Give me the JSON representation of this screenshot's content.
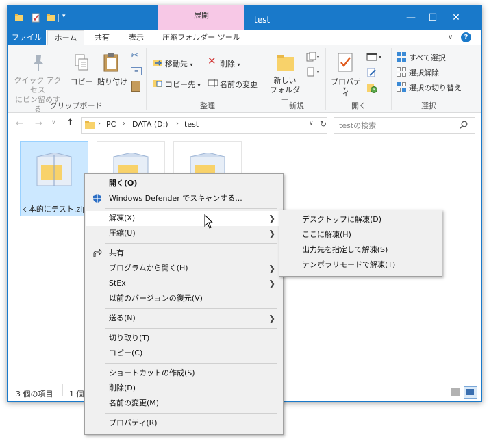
{
  "window": {
    "title": "test",
    "context_tab": "展開",
    "controls": {
      "minimize": "—",
      "maximize": "☐",
      "close": "✕"
    }
  },
  "tabs": {
    "file": "ファイル",
    "home": "ホーム",
    "share": "共有",
    "view": "表示",
    "context_tool": "圧縮フォルダー ツール"
  },
  "ribbon": {
    "clipboard": {
      "label": "クリップボード",
      "pin_line1": "クイック アクセス",
      "pin_line2": "にピン留めする",
      "copy": "コピー",
      "paste": "貼り付け"
    },
    "organize": {
      "label": "整理",
      "move_to": "移動先",
      "copy_to": "コピー先",
      "delete": "削除",
      "rename": "名前の変更"
    },
    "new": {
      "label": "新規",
      "new_folder_line1": "新しい",
      "new_folder_line2": "フォルダー"
    },
    "open": {
      "label": "開く",
      "properties": "プロパティ"
    },
    "select": {
      "label": "選択",
      "select_all": "すべて選択",
      "select_none": "選択解除",
      "invert": "選択の切り替え"
    }
  },
  "address": {
    "crumbs": [
      "PC",
      "DATA (D:)",
      "test"
    ],
    "search_placeholder": "testの検索"
  },
  "files": [
    {
      "name": "k 本的にテスト.zip"
    }
  ],
  "status": {
    "items": "3 個の項目",
    "selected": "1 個"
  },
  "context_menu": {
    "open": "開く(O)",
    "defender": "Windows Defender でスキャンする...",
    "extract": "解凍(X)",
    "compress": "圧縮(U)",
    "share": "共有",
    "open_with": "プログラムから開く(H)",
    "stex": "StEx",
    "restore": "以前のバージョンの復元(V)",
    "send_to": "送る(N)",
    "cut": "切り取り(T)",
    "copy": "コピー(C)",
    "create_shortcut": "ショートカットの作成(S)",
    "delete": "削除(D)",
    "rename": "名前の変更(M)",
    "properties": "プロパティ(R)"
  },
  "submenu": {
    "desktop": "デスクトップに解凍(D)",
    "here": "ここに解凍(H)",
    "specify": "出力先を指定して解凍(S)",
    "temp": "テンポラリモードで解凍(T)"
  },
  "colors": {
    "accent": "#1979ca",
    "context_tab": "#f7c8e6",
    "selection": "#cce8ff"
  }
}
